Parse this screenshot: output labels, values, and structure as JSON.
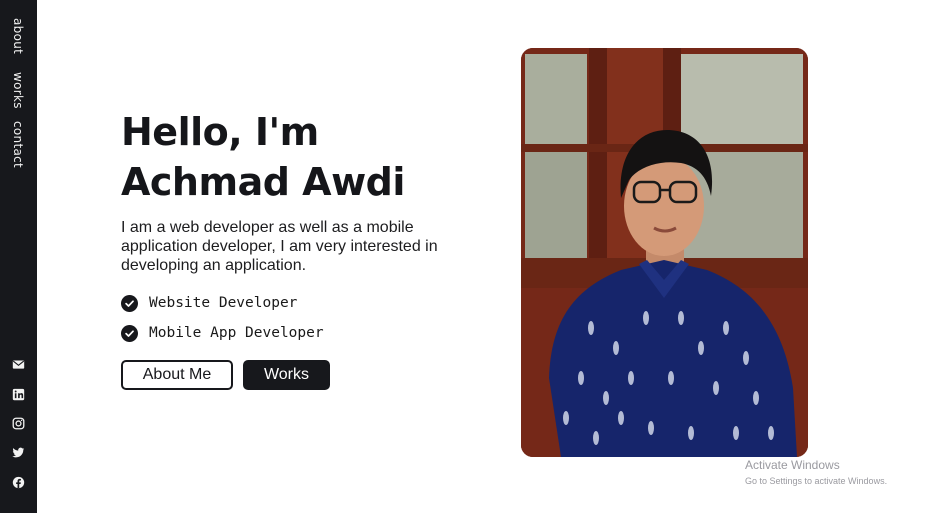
{
  "sidebar": {
    "nav": [
      {
        "label": "about"
      },
      {
        "label": "works"
      },
      {
        "label": "contact"
      }
    ],
    "social_icons": [
      "mail-icon",
      "linkedin-icon",
      "instagram-icon",
      "twitter-icon",
      "facebook-icon"
    ]
  },
  "hero": {
    "title_line1": "Hello, I'm",
    "title_line2": "Achmad Awdi",
    "description": "I am a web developer as well as a mobile application developer, I am very interested in developing an application.",
    "skills": [
      {
        "label": "Website Developer",
        "icon": "check-circle-icon"
      },
      {
        "label": "Mobile App Developer",
        "icon": "check-circle-icon"
      }
    ],
    "buttons": {
      "about_label": "About Me",
      "works_label": "Works"
    }
  },
  "photo": {
    "icon": "profile-photo"
  },
  "watermark": {
    "title": "Activate Windows",
    "subtitle": "Go to Settings to activate Windows."
  },
  "colors": {
    "sidebar_bg": "#17181c",
    "text_dark": "#15161a",
    "background": "#ffffff",
    "photo_frame": "#6b2414"
  }
}
